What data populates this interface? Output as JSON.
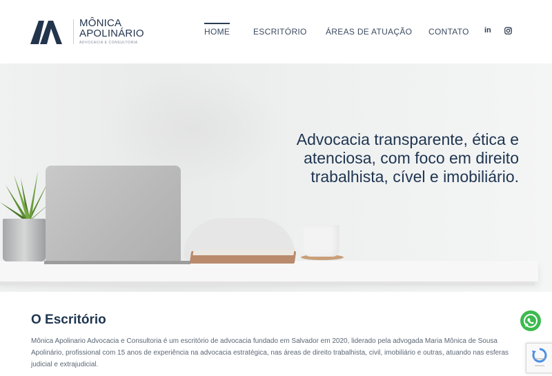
{
  "logo": {
    "name_line1": "MÔNICA",
    "name_line2": "APOLINÁRIO",
    "tagline": "ADVOCACIA E CONSULTORIA",
    "brand_color": "#23344d"
  },
  "nav": {
    "items": [
      {
        "label": "HOME",
        "active": true
      },
      {
        "label": "ESCRITÓRIO",
        "active": false
      },
      {
        "label": "ÁREAS DE ATUAÇÃO",
        "active": false
      },
      {
        "label": "CONTATO",
        "active": false
      }
    ],
    "social": [
      {
        "icon": "linkedin-icon",
        "label": "in"
      },
      {
        "icon": "instagram-icon",
        "label": ""
      }
    ]
  },
  "hero": {
    "headline": "Advocacia transparente, ética e atenciosa, com foco em direito trabalhista, cível e imobiliário."
  },
  "about": {
    "title": "O Escritório",
    "body": "Mônica Apolinario Advocacia e Consultoria é um escritório de advocacia fundado em Salvador em 2020, liderado pela advogada Maria Mônica de Sousa Apolinário, profissional com 15 anos de experiência na advocacia estratégica, nas áreas de direito trabalhista, civil, imobiliário e outras, atuando nas esferas judicial e extrajudicial."
  },
  "floating": {
    "whatsapp_icon": "whatsapp-icon",
    "whatsapp_color": "#3dba4f",
    "recaptcha_icon": "recaptcha-icon"
  }
}
